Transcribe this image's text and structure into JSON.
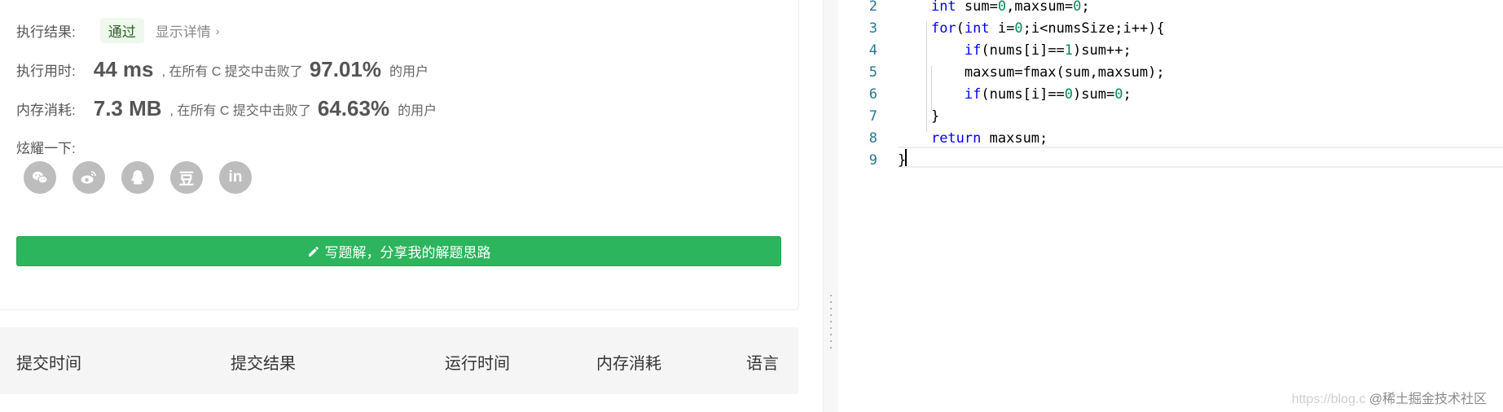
{
  "result": {
    "label": "执行结果:",
    "status": "通过",
    "detail_link": "显示详情",
    "chevron": "›"
  },
  "runtime": {
    "label": "执行用时:",
    "value": "44 ms",
    "prefix": ", 在所有 C 提交中击败了",
    "percent": "97.01%",
    "suffix": "的用户"
  },
  "memory": {
    "label": "内存消耗:",
    "value": "7.3 MB",
    "prefix": ", 在所有 C 提交中击败了",
    "percent": "64.63%",
    "suffix": "的用户"
  },
  "share": {
    "label": "炫耀一下:",
    "icons": [
      "wechat-icon",
      "weibo-icon",
      "qq-icon",
      "douban-icon",
      "linkedin-icon"
    ],
    "douban_glyph": "豆",
    "linkedin_glyph": "in"
  },
  "write_button": {
    "label": "写题解，分享我的解题思路",
    "icon": "pencil-icon"
  },
  "table": {
    "headers": [
      "提交时间",
      "提交结果",
      "运行时间",
      "内存消耗",
      "语言"
    ]
  },
  "editor": {
    "lines": [
      {
        "n": "2",
        "text": "    int sum=0,maxsum=0;"
      },
      {
        "n": "3",
        "text": "    for(int i=0;i<numsSize;i++){"
      },
      {
        "n": "4",
        "text": "        if(nums[i]==1)sum++;"
      },
      {
        "n": "5",
        "text": "        maxsum=fmax(sum,maxsum);"
      },
      {
        "n": "6",
        "text": "        if(nums[i]==0)sum=0;"
      },
      {
        "n": "7",
        "text": "    }"
      },
      {
        "n": "8",
        "text": "    return maxsum;"
      },
      {
        "n": "9",
        "text": "}"
      }
    ]
  },
  "watermark": {
    "url": "https://blog.c",
    "main": "@稀土掘金技术社区"
  },
  "colors": {
    "accent_green": "#2db55d",
    "badge_bg": "#eef8ec",
    "line_number": "#237893",
    "keyword": "#0000ff",
    "number": "#098658"
  }
}
